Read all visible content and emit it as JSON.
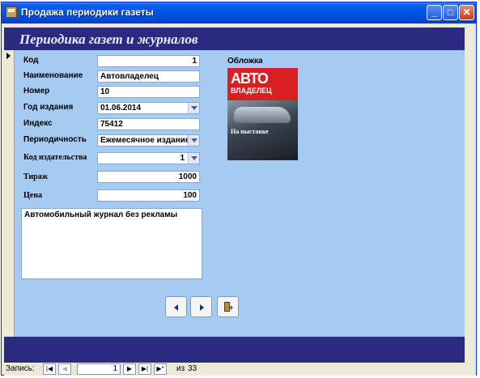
{
  "window": {
    "title": "Продажа периодики газеты"
  },
  "titlebar_buttons": {
    "minimize": "_",
    "maximize": "□",
    "close": "✕"
  },
  "form": {
    "heading": "Периодика газет и журналов"
  },
  "fields": {
    "kod": {
      "label": "Код",
      "value": "1"
    },
    "name": {
      "label": "Наименование",
      "value": "Автовладелец"
    },
    "number": {
      "label": "Номер",
      "value": "10"
    },
    "year": {
      "label": "Год издания",
      "value": "01.06.2014"
    },
    "index": {
      "label": "Индекс",
      "value": "75412"
    },
    "periodicity": {
      "label": "Периодичность",
      "value": "Ежемесячное издание"
    },
    "publisher_code": {
      "label": "Код издательства",
      "value": "1"
    },
    "circulation": {
      "label": "Тираж",
      "value": "1000"
    },
    "price": {
      "label": "Цена",
      "value": "100"
    },
    "description": {
      "value": "Автомобильный журнал без рекламы"
    }
  },
  "cover": {
    "label": "Обложка",
    "logo_top": "АВТО",
    "logo_bottom": "ВЛАДЕЛЕЦ",
    "caption": "На выставке"
  },
  "statusbar": {
    "record_label": "Запись:",
    "current": "1",
    "of": "из",
    "total": "33",
    "first_btn": "|◀",
    "prev_btn": "◀",
    "next_btn": "▶",
    "last_btn": "▶|",
    "new_btn": "▶*"
  },
  "colors": {
    "header_bg": "#292a80",
    "detail_bg": "#a6cbf3",
    "titlebar": "#0054e3"
  }
}
